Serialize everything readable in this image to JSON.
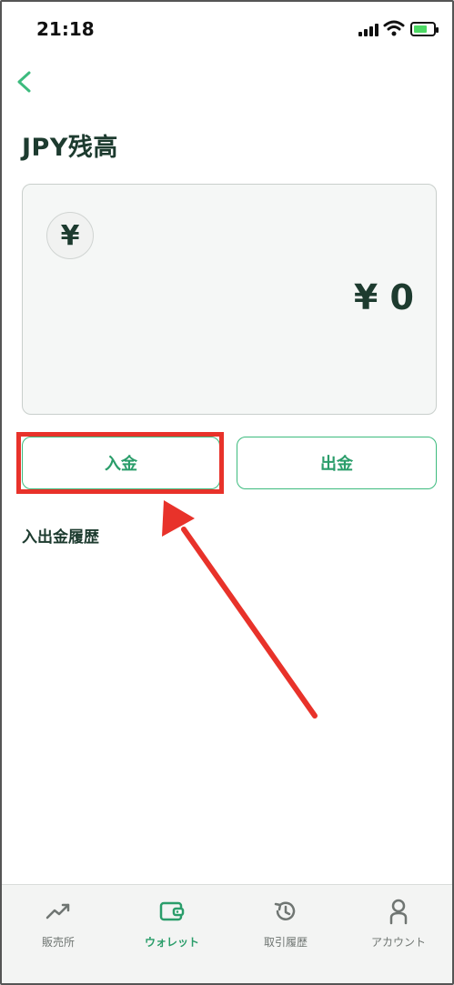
{
  "status": {
    "time": "21:18"
  },
  "header": {
    "title": "JPY残高"
  },
  "balance": {
    "currency_symbol": "¥",
    "amount": "¥ 0"
  },
  "actions": {
    "deposit_label": "入金",
    "withdraw_label": "出金"
  },
  "history": {
    "title": "入出金履歴"
  },
  "tabs": [
    {
      "label": "販売所",
      "icon": "trend-up-icon",
      "active": false
    },
    {
      "label": "ウォレット",
      "icon": "wallet-icon",
      "active": true
    },
    {
      "label": "取引履歴",
      "icon": "history-icon",
      "active": false
    },
    {
      "label": "アカウント",
      "icon": "person-icon",
      "active": false
    }
  ],
  "colors": {
    "accent": "#2a9d6a",
    "accent_border": "#3dbb7e",
    "highlight": "#e8322a",
    "text": "#1d3b2f"
  }
}
